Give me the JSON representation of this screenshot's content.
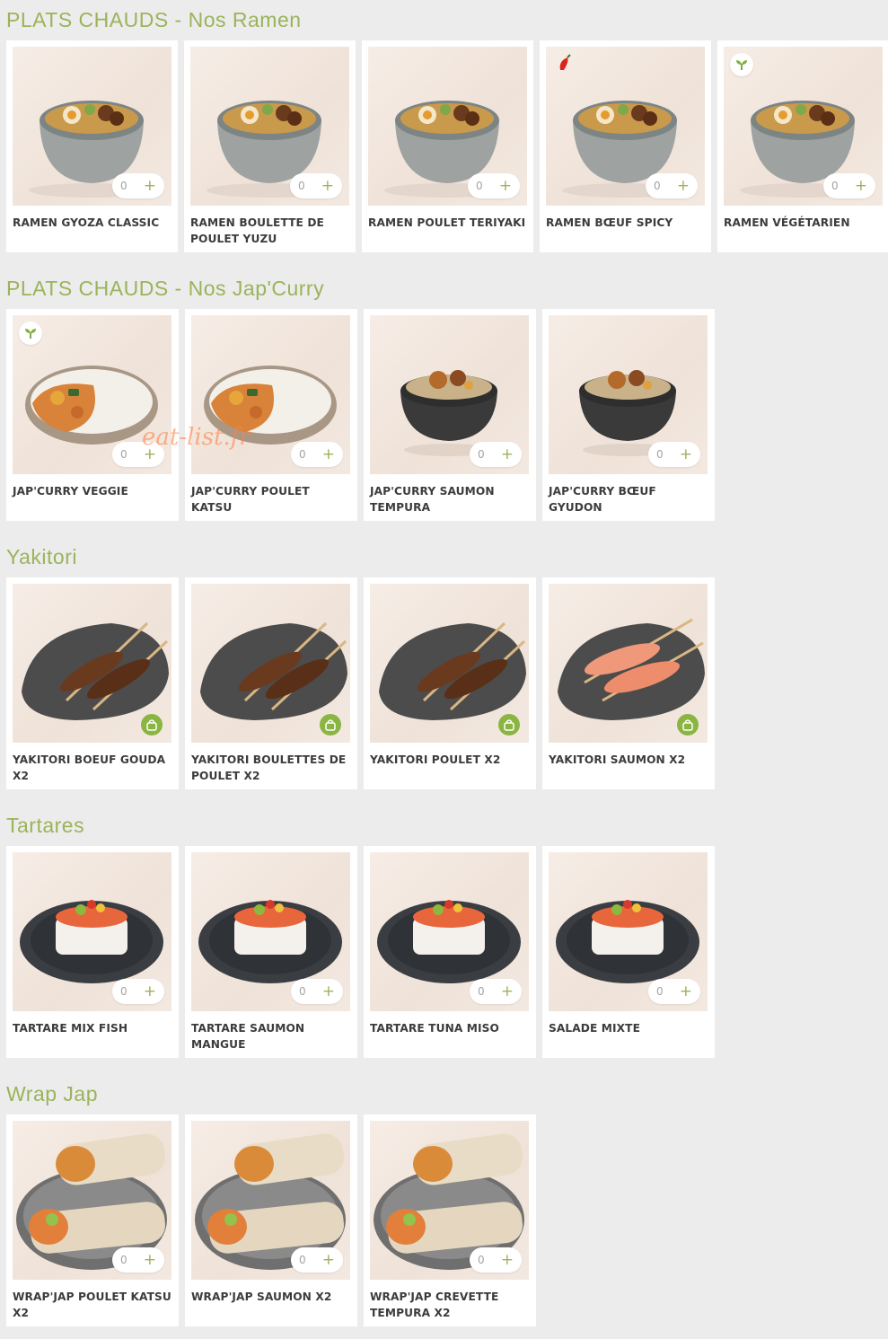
{
  "sections": [
    {
      "title": "PLATS CHAUDS - Nos Ramen",
      "items": [
        {
          "name": "RAMEN GYOZA CLASSIC",
          "qty": "0",
          "kind": "ramen"
        },
        {
          "name": "RAMEN BOULETTE DE POULET YUZU",
          "qty": "0",
          "kind": "ramen"
        },
        {
          "name": "RAMEN POULET TERIYAKI",
          "qty": "0",
          "kind": "ramen"
        },
        {
          "name": "RAMEN BŒUF SPICY",
          "qty": "0",
          "kind": "ramen",
          "badge": "chili-icon"
        },
        {
          "name": "RAMEN VÉGÉTARIEN",
          "qty": "0",
          "kind": "ramen",
          "badge": "vegetarian-leaf-icon"
        }
      ]
    },
    {
      "title": "PLATS CHAUDS - Nos Jap'Curry",
      "items": [
        {
          "name": "JAP'CURRY VEGGIE",
          "qty": "0",
          "kind": "curry",
          "badge": "vegetarian-leaf-icon"
        },
        {
          "name": "JAP'CURRY POULET KATSU",
          "qty": "0",
          "kind": "curry"
        },
        {
          "name": "JAP'CURRY SAUMON TEMPURA",
          "qty": "0",
          "kind": "darkbowl"
        },
        {
          "name": "JAP'CURRY BŒUF GYUDON",
          "qty": "0",
          "kind": "darkbowl"
        }
      ]
    },
    {
      "title": "Yakitori",
      "items": [
        {
          "name": "YAKITORI BOEUF GOUDA X2",
          "kind": "yakitori"
        },
        {
          "name": "YAKITORI BOULETTES DE POULET X2",
          "kind": "yakitori"
        },
        {
          "name": "YAKITORI POULET X2",
          "kind": "yakitori"
        },
        {
          "name": "YAKITORI SAUMON X2",
          "kind": "yakitori-salmon"
        }
      ]
    },
    {
      "title": "Tartares",
      "items": [
        {
          "name": "TARTARE MIX FISH",
          "qty": "0",
          "kind": "tartare"
        },
        {
          "name": "TARTARE SAUMON MANGUE",
          "qty": "0",
          "kind": "tartare"
        },
        {
          "name": "TARTARE TUNA MISO",
          "qty": "0",
          "kind": "tartare"
        },
        {
          "name": "SALADE MIXTE",
          "qty": "0",
          "kind": "tartare"
        }
      ]
    },
    {
      "title": "Wrap Jap",
      "items": [
        {
          "name": "WRAP'JAP POULET KATSU X2",
          "qty": "0",
          "kind": "wrap"
        },
        {
          "name": "WRAP'JAP SAUMON X2",
          "qty": "0",
          "kind": "wrap"
        },
        {
          "name": "WRAP'JAP CREVETTE TEMPURA X2",
          "qty": "0",
          "kind": "wrap"
        }
      ]
    }
  ],
  "watermark": "eat-list.fr",
  "colors": {
    "accent": "#9bb35a",
    "bag": "#8bb542",
    "background": "#ececec"
  }
}
